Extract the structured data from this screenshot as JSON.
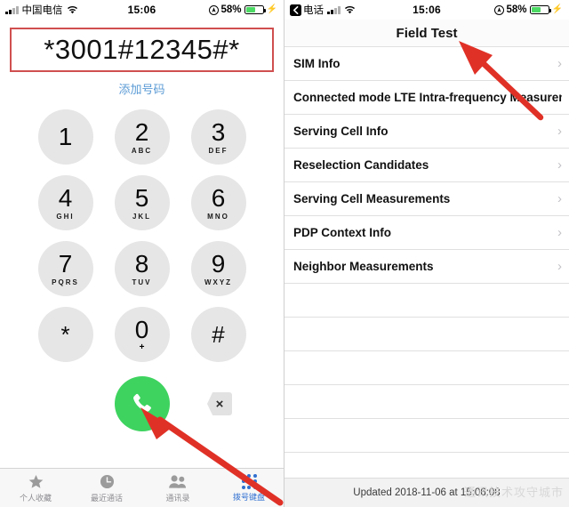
{
  "left_phone": {
    "status_bar": {
      "carrier": "中国电信",
      "time": "15:06",
      "battery_percent": "58%",
      "icons": [
        "signal-bars-icon",
        "wifi-icon",
        "location-icon",
        "battery-icon",
        "charging-bolt-icon"
      ]
    },
    "dialer": {
      "entered_number": "*3001#12345#*",
      "add_number_label": "添加号码",
      "keys": [
        {
          "digit": "1",
          "letters": ""
        },
        {
          "digit": "2",
          "letters": "ABC"
        },
        {
          "digit": "3",
          "letters": "DEF"
        },
        {
          "digit": "4",
          "letters": "GHI"
        },
        {
          "digit": "5",
          "letters": "JKL"
        },
        {
          "digit": "6",
          "letters": "MNO"
        },
        {
          "digit": "7",
          "letters": "PQRS"
        },
        {
          "digit": "8",
          "letters": "TUV"
        },
        {
          "digit": "9",
          "letters": "WXYZ"
        },
        {
          "digit": "*",
          "letters": ""
        },
        {
          "digit": "0",
          "letters": "+"
        },
        {
          "digit": "#",
          "letters": ""
        }
      ],
      "call_button": "call-icon",
      "delete_button": "×"
    },
    "tab_bar": [
      {
        "label": "个人收藏",
        "icon": "star-icon",
        "active": false
      },
      {
        "label": "最近通话",
        "icon": "clock-icon",
        "active": false
      },
      {
        "label": "通讯录",
        "icon": "contacts-icon",
        "active": false
      },
      {
        "label": "拨号键盘",
        "icon": "keypad-icon",
        "active": true
      }
    ]
  },
  "right_phone": {
    "status_bar": {
      "back_label": "电话",
      "time": "15:06",
      "battery_percent": "58%"
    },
    "title": "Field Test",
    "rows": [
      {
        "label": "SIM Info",
        "chevron": true
      },
      {
        "label": "Connected mode LTE Intra-frequency Measurements",
        "chevron": false
      },
      {
        "label": "Serving Cell Info",
        "chevron": true
      },
      {
        "label": "Reselection Candidates",
        "chevron": true
      },
      {
        "label": "Serving Cell Measurements",
        "chevron": true
      },
      {
        "label": "PDP Context Info",
        "chevron": true
      },
      {
        "label": "Neighbor Measurements",
        "chevron": true
      }
    ],
    "footer": "Updated 2018-11-06 at 15:06:08",
    "watermark": "通讯技术攻守城市"
  },
  "annotations": {
    "arrow_left_target": "call-button",
    "arrow_right_target": "field-test-title",
    "arrow_color": "#e03127"
  }
}
